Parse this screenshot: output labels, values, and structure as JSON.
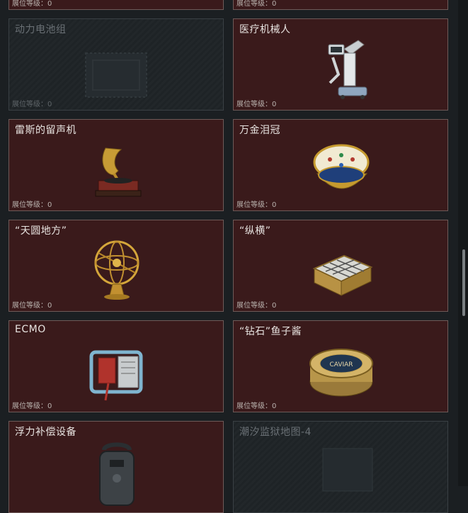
{
  "level_label": "展位等级：0",
  "cards": [
    {
      "title": "",
      "level": "展位等级：0",
      "locked": false,
      "icon": "none"
    },
    {
      "title": "",
      "level": "展位等级：0",
      "locked": false,
      "icon": "none"
    },
    {
      "title": "动力电池组",
      "level": "展位等级：0",
      "locked": true,
      "icon": "battery-pack-icon"
    },
    {
      "title": "医疗机械人",
      "level": "展位等级：0",
      "locked": false,
      "icon": "medical-robot-icon"
    },
    {
      "title": "雷斯的留声机",
      "level": "展位等级：0",
      "locked": false,
      "icon": "gramophone-icon"
    },
    {
      "title": "万金泪冠",
      "level": "展位等级：0",
      "locked": false,
      "icon": "jeweled-egg-icon"
    },
    {
      "title": "“天圆地方”",
      "level": "展位等级：0",
      "locked": false,
      "icon": "armillary-sphere-icon"
    },
    {
      "title": "“纵横”",
      "level": "展位等级：0",
      "locked": false,
      "icon": "chessboard-icon"
    },
    {
      "title": "ECMO",
      "level": "展位等级：0",
      "locked": false,
      "icon": "ecmo-machine-icon"
    },
    {
      "title": "“钻石”鱼子酱",
      "level": "展位等级：0",
      "locked": false,
      "icon": "caviar-tin-icon"
    },
    {
      "title": "浮力补偿设备",
      "level": "",
      "locked": false,
      "icon": "buoyancy-device-icon"
    },
    {
      "title": "潮汐监狱地图-4",
      "level": "",
      "locked": true,
      "icon": "map-icon"
    }
  ],
  "caviar_text": "CAVIAR",
  "colors": {
    "card_bg": "#3a1a1b",
    "card_border": "#6e5a58",
    "locked_bg": "#22272a",
    "page_bg": "#1b1f22"
  }
}
